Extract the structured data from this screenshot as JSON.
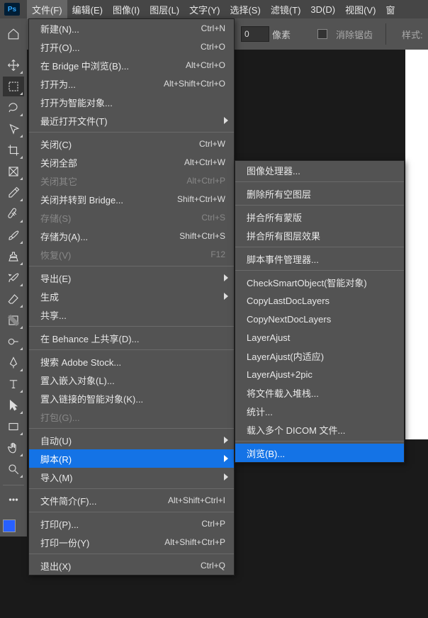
{
  "app": {
    "ps_logo": "Ps"
  },
  "menubar": [
    "文件(F)",
    "编辑(E)",
    "图像(I)",
    "图层(L)",
    "文字(Y)",
    "选择(S)",
    "滤镜(T)",
    "3D(D)",
    "视图(V)",
    "窗"
  ],
  "options": {
    "pixels_label": "像素",
    "pixels_value": "0",
    "antialias": "消除锯齿",
    "style": "样式:"
  },
  "tools": [
    "move",
    "marquee",
    "lasso",
    "quick-select",
    "crop",
    "perspective-crop",
    "eyedropper",
    "healing",
    "brush",
    "clone",
    "history-brush",
    "eraser",
    "gradient",
    "dodge",
    "pen",
    "type",
    "path-select",
    "rectangle",
    "hand",
    "zoom"
  ],
  "file_menu": [
    {
      "label": "新建(N)...",
      "shortcut": "Ctrl+N"
    },
    {
      "label": "打开(O)...",
      "shortcut": "Ctrl+O"
    },
    {
      "label": "在 Bridge 中浏览(B)...",
      "shortcut": "Alt+Ctrl+O"
    },
    {
      "label": "打开为...",
      "shortcut": "Alt+Shift+Ctrl+O"
    },
    {
      "label": "打开为智能对象..."
    },
    {
      "label": "最近打开文件(T)",
      "submenu": true
    },
    {
      "sep": true
    },
    {
      "label": "关闭(C)",
      "shortcut": "Ctrl+W"
    },
    {
      "label": "关闭全部",
      "shortcut": "Alt+Ctrl+W"
    },
    {
      "label": "关闭其它",
      "shortcut": "Alt+Ctrl+P",
      "disabled": true
    },
    {
      "label": "关闭并转到 Bridge...",
      "shortcut": "Shift+Ctrl+W"
    },
    {
      "label": "存储(S)",
      "shortcut": "Ctrl+S",
      "disabled": true
    },
    {
      "label": "存储为(A)...",
      "shortcut": "Shift+Ctrl+S"
    },
    {
      "label": "恢复(V)",
      "shortcut": "F12",
      "disabled": true
    },
    {
      "sep": true
    },
    {
      "label": "导出(E)",
      "submenu": true
    },
    {
      "label": "生成",
      "submenu": true
    },
    {
      "label": "共享..."
    },
    {
      "sep": true
    },
    {
      "label": "在 Behance 上共享(D)..."
    },
    {
      "sep": true
    },
    {
      "label": "搜索 Adobe Stock..."
    },
    {
      "label": "置入嵌入对象(L)..."
    },
    {
      "label": "置入链接的智能对象(K)..."
    },
    {
      "label": "打包(G)...",
      "disabled": true
    },
    {
      "sep": true
    },
    {
      "label": "自动(U)",
      "submenu": true
    },
    {
      "label": "脚本(R)",
      "submenu": true,
      "highlight": true
    },
    {
      "label": "导入(M)",
      "submenu": true
    },
    {
      "sep": true
    },
    {
      "label": "文件简介(F)...",
      "shortcut": "Alt+Shift+Ctrl+I"
    },
    {
      "sep": true
    },
    {
      "label": "打印(P)...",
      "shortcut": "Ctrl+P"
    },
    {
      "label": "打印一份(Y)",
      "shortcut": "Alt+Shift+Ctrl+P"
    },
    {
      "sep": true
    },
    {
      "label": "退出(X)",
      "shortcut": "Ctrl+Q"
    }
  ],
  "script_submenu": [
    {
      "label": "图像处理器..."
    },
    {
      "sep": true
    },
    {
      "label": "删除所有空图层"
    },
    {
      "sep": true
    },
    {
      "label": "拼合所有蒙版"
    },
    {
      "label": "拼合所有图层效果"
    },
    {
      "sep": true
    },
    {
      "label": "脚本事件管理器..."
    },
    {
      "sep": true
    },
    {
      "label": "CheckSmartObject(智能对象)"
    },
    {
      "label": "CopyLastDocLayers"
    },
    {
      "label": "CopyNextDocLayers"
    },
    {
      "label": "LayerAjust"
    },
    {
      "label": "LayerAjust(内适应)"
    },
    {
      "label": "LayerAjust+2pic"
    },
    {
      "label": "将文件载入堆栈..."
    },
    {
      "label": "统计..."
    },
    {
      "label": "载入多个 DICOM 文件..."
    },
    {
      "sep": true
    },
    {
      "label": "浏览(B)...",
      "highlight": true
    }
  ]
}
